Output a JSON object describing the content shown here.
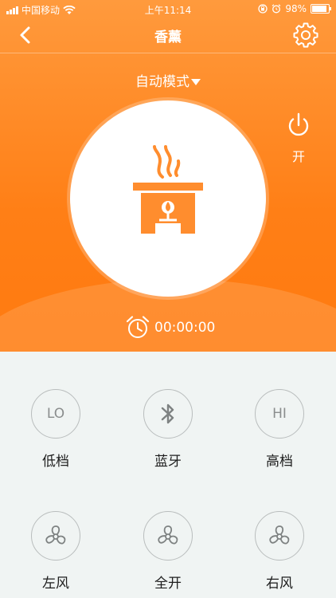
{
  "status_bar": {
    "carrier": "中国移动",
    "time": "上午11:14",
    "battery": "98%"
  },
  "nav": {
    "title": "香薰"
  },
  "mode": {
    "label": "自动模式"
  },
  "power": {
    "label": "开"
  },
  "timer": {
    "value": "00:00:00"
  },
  "controls": [
    {
      "icon_text": "LO",
      "label": "低档"
    },
    {
      "icon_text": "",
      "label": "蓝牙",
      "icon": "bluetooth-icon"
    },
    {
      "icon_text": "HI",
      "label": "高档"
    },
    {
      "icon_text": "",
      "label": "左风",
      "icon": "fan-icon"
    },
    {
      "icon_text": "",
      "label": "全开",
      "icon": "fan-icon"
    },
    {
      "icon_text": "",
      "label": "右风",
      "icon": "fan-icon"
    }
  ],
  "colors": {
    "accent": "#ff8a24",
    "background": "#f0f4f3"
  }
}
